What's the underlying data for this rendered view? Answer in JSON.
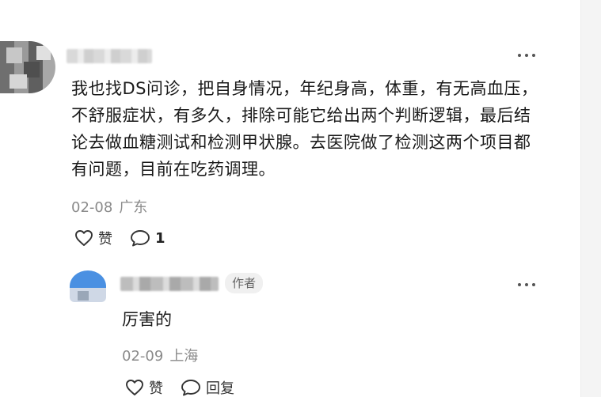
{
  "comment": {
    "text": "我也找DS问诊，把自身情况，年纪身高，体重，有无高血压，不舒服症状，有多久，排除可能它给出两个判断逻辑，最后结论去做血糖测试和检测甲状腺。去医院做了检测这两个项目都有问题，目前在吃药调理。",
    "date": "02-08",
    "region": "广东",
    "like_label": "赞",
    "reply_count": "1"
  },
  "reply": {
    "badge": "作者",
    "text": "厉害的",
    "date": "02-09",
    "region": "上海",
    "like_label": "赞",
    "reply_label": "回复"
  },
  "icons": {
    "like": "heart-icon",
    "comment": "speech-bubble-icon",
    "more": "more-dots-icon"
  }
}
